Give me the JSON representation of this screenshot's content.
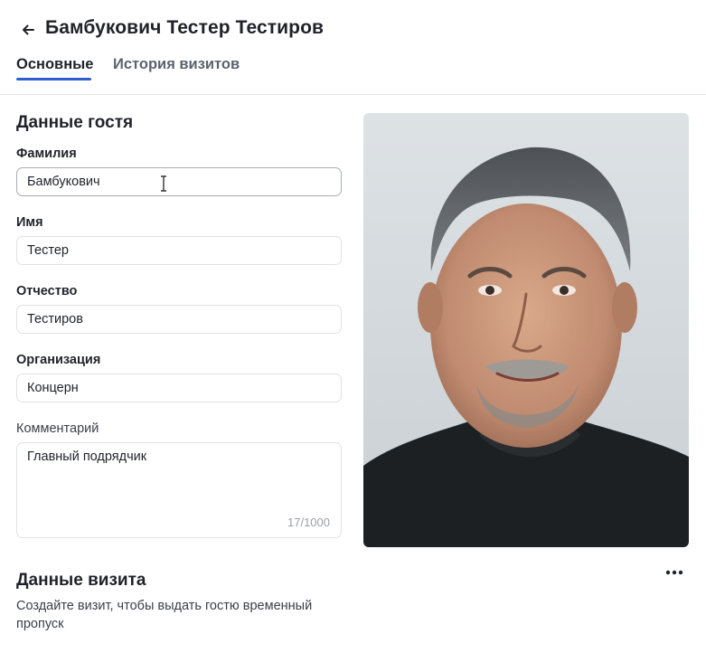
{
  "header": {
    "title": "Бамбукович Тестер Тестиров",
    "tabs": [
      {
        "label": "Основные",
        "active": true
      },
      {
        "label": "История визитов",
        "active": false
      }
    ]
  },
  "guest": {
    "section_title": "Данные гостя",
    "last_name": {
      "label": "Фамилия",
      "value": "Бамбукович"
    },
    "first_name": {
      "label": "Имя",
      "value": "Тестер"
    },
    "patronymic": {
      "label": "Отчество",
      "value": "Тестиров"
    },
    "organization": {
      "label": "Организация",
      "value": "Концерн"
    },
    "comment": {
      "label": "Комментарий",
      "value": "Главный подрядчик",
      "counter": "17/1000"
    }
  },
  "visit": {
    "section_title": "Данные визита",
    "description": "Создайте визит, чтобы выдать гостю временный пропуск"
  },
  "icons": {
    "back": "arrow-left-icon",
    "more": "more-horizontal-icon",
    "cursor": "text-cursor-icon"
  },
  "colors": {
    "accent": "#2f5fd1",
    "text": "#1f2329",
    "muted": "#5b6370",
    "border": "#e0e2e6"
  }
}
